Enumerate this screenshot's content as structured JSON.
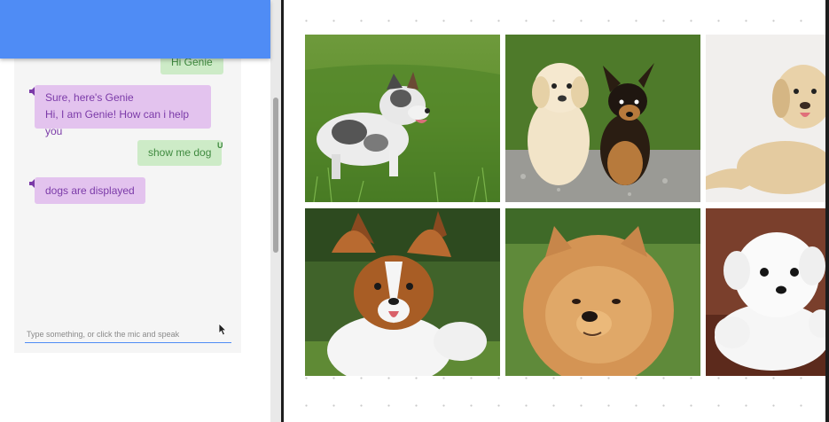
{
  "chat": {
    "messages": [
      {
        "sender": "user",
        "text": "Hi Genie"
      },
      {
        "sender": "bot",
        "lines": [
          "Sure, here's Genie",
          "Hi, I am Genie! How can i help you"
        ]
      },
      {
        "sender": "user",
        "text": "show me dog",
        "badge": "U"
      },
      {
        "sender": "bot",
        "text": "dogs are displayed"
      }
    ],
    "input_placeholder": "Type something, or click the mic and speak"
  },
  "colors": {
    "header": "#4f8cf5",
    "user_bubble": "#cdebc7",
    "bot_bubble": "#e3c3ee"
  },
  "gallery": {
    "images": [
      {
        "subject": "australian shepherd puppy running in grass"
      },
      {
        "subject": "labrador puppy and terrier puppy sitting"
      },
      {
        "subject": "labrador retriever lying down"
      },
      {
        "subject": "papillon dog in grass"
      },
      {
        "subject": "chow chow dog"
      },
      {
        "subject": "white fluffy puppy"
      }
    ]
  }
}
